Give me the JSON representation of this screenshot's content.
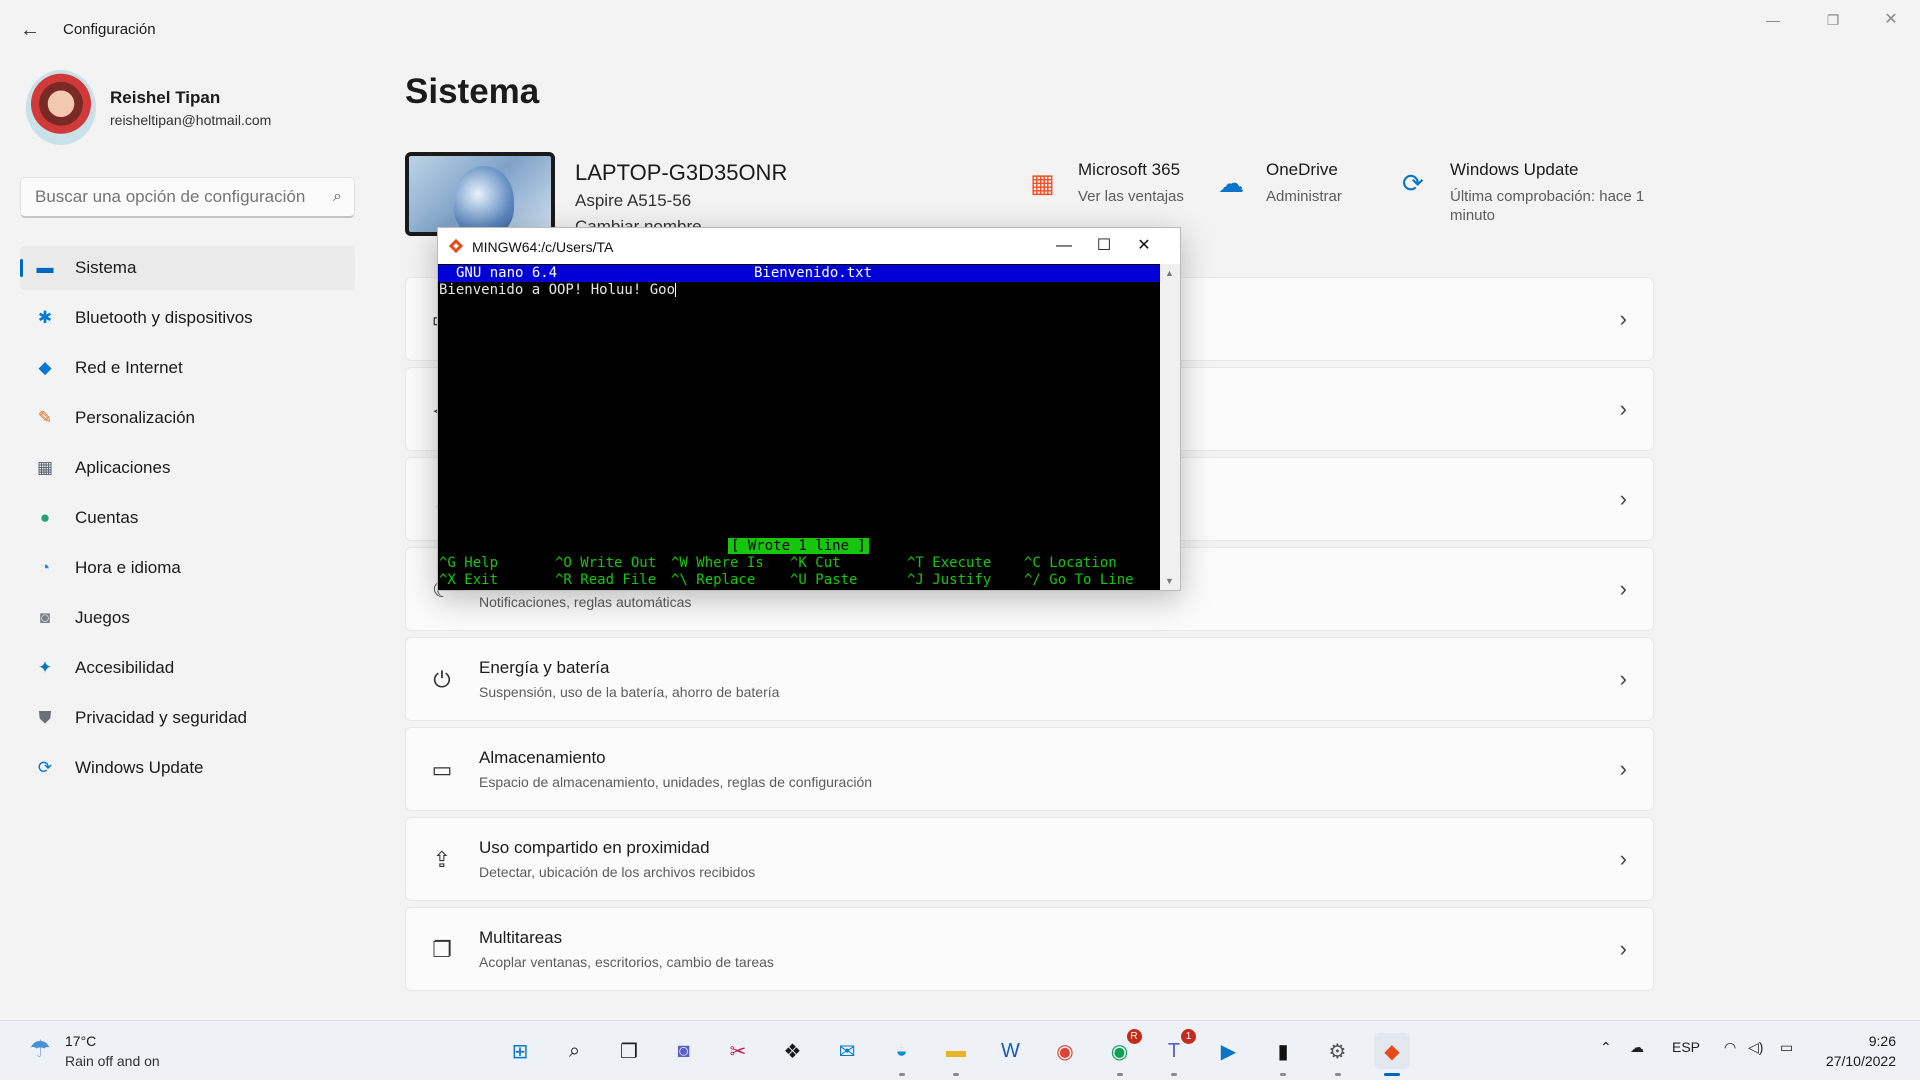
{
  "window": {
    "title": "Configuración",
    "back_icon": "←",
    "min_icon": "—",
    "max_icon": "❐",
    "close_icon": "✕"
  },
  "profile": {
    "name": "Reishel Tipan",
    "email": "reisheltipan@hotmail.com"
  },
  "search": {
    "placeholder": "Buscar una opción de configuración",
    "icon": "⌕"
  },
  "sidebar": {
    "items": [
      {
        "label": "Sistema",
        "icon": "▬",
        "color": "#0067c0",
        "active": true
      },
      {
        "label": "Bluetooth y dispositivos",
        "icon": "✱",
        "color": "#0078d4"
      },
      {
        "label": "Red e Internet",
        "icon": "◆",
        "color": "#0078d4"
      },
      {
        "label": "Personalización",
        "icon": "✎",
        "color": "#d46a1a"
      },
      {
        "label": "Aplicaciones",
        "icon": "▦",
        "color": "#555f6e"
      },
      {
        "label": "Cuentas",
        "icon": "●",
        "color": "#1fa37a"
      },
      {
        "label": "Hora e idioma",
        "icon": "◔",
        "color": "#2f86d6"
      },
      {
        "label": "Juegos",
        "icon": "◙",
        "color": "#7a7f88"
      },
      {
        "label": "Accesibilidad",
        "icon": "✦",
        "color": "#0a74c9"
      },
      {
        "label": "Privacidad y seguridad",
        "icon": "⛊",
        "color": "#6b7079"
      },
      {
        "label": "Windows Update",
        "icon": "⟳",
        "color": "#0a74c9"
      }
    ]
  },
  "main": {
    "title": "Sistema",
    "device": {
      "name": "LAPTOP-G3D35ONR",
      "model": "Aspire A515-56",
      "rename": "Cambiar nombre"
    },
    "tiles": [
      {
        "title": "Microsoft 365",
        "sub": "Ver las ventajas",
        "icon": "▦"
      },
      {
        "title": "OneDrive",
        "sub": "Administrar",
        "icon": "☁"
      },
      {
        "title": "Windows Update",
        "sub": "Última comprobación: hace 1 minuto",
        "icon": "⟳"
      }
    ],
    "cards": [
      {
        "title": "",
        "sub": "",
        "icon": "▭"
      },
      {
        "title": "",
        "sub": "",
        "icon": "◁"
      },
      {
        "title": "",
        "sub": "",
        "icon": "♫"
      },
      {
        "title": "",
        "sub": "Notificaciones, reglas automáticas",
        "icon": "☾"
      },
      {
        "title": "Energía y batería",
        "sub": "Suspensión, uso de la batería, ahorro de batería",
        "icon": "⏻"
      },
      {
        "title": "Almacenamiento",
        "sub": "Espacio de almacenamiento, unidades, reglas de configuración",
        "icon": "▭"
      },
      {
        "title": "Uso compartido en proximidad",
        "sub": "Detectar, ubicación de los archivos recibidos",
        "icon": "⇪"
      },
      {
        "title": "Multitareas",
        "sub": "Acoplar ventanas, escritorios, cambio de tareas",
        "icon": "❐"
      }
    ],
    "chevron": "›"
  },
  "terminal": {
    "title": "MINGW64:/c/Users/TA",
    "min_icon": "—",
    "max_icon": "☐",
    "close_icon": "✕",
    "nano_version": "GNU nano 6.4",
    "filename": "Bienvenido.txt",
    "content": "Bienvenido a OOP! Holuu! Goo",
    "status": "[ Wrote 1 line ]",
    "shortcuts_row1": [
      "^G Help",
      "^O Write Out",
      "^W Where Is",
      "^K Cut",
      "^T Execute",
      "^C Location"
    ],
    "shortcuts_row2": [
      "^X Exit",
      "^R Read File",
      "^\\ Replace",
      "^U Paste",
      "^J Justify",
      "^/ Go To Line"
    ]
  },
  "taskbar": {
    "weather": {
      "temp": "17°C",
      "desc": "Rain off and on",
      "icon": "☂"
    },
    "apps": [
      {
        "name": "start",
        "icon": "⊞",
        "color": "#0078d4"
      },
      {
        "name": "search",
        "icon": "⌕",
        "color": "#222"
      },
      {
        "name": "task-view",
        "icon": "❐",
        "color": "#222"
      },
      {
        "name": "chat",
        "icon": "◙",
        "color": "#5b5fc7"
      },
      {
        "name": "snipping-tool",
        "icon": "✂",
        "color": "#c2185b"
      },
      {
        "name": "dropbox",
        "icon": "❖",
        "color": "#1a1a1a"
      },
      {
        "name": "mail",
        "icon": "✉",
        "color": "#0078d4"
      },
      {
        "name": "edge",
        "icon": "◒",
        "color": "#0c8bd6"
      },
      {
        "name": "file-explorer",
        "icon": "▬",
        "color": "#e8b22a"
      },
      {
        "name": "word",
        "icon": "W",
        "color": "#185abd"
      },
      {
        "name": "chrome",
        "icon": "◉",
        "color": "#db4437"
      },
      {
        "name": "chrome-profile",
        "icon": "◉",
        "color": "#0f9d58",
        "badge": "R"
      },
      {
        "name": "teams",
        "icon": "T",
        "color": "#5b5fc7",
        "badge": "1"
      },
      {
        "name": "media-player",
        "icon": "▶",
        "color": "#0a74c9"
      },
      {
        "name": "terminal",
        "icon": "▮",
        "color": "#111"
      },
      {
        "name": "settings",
        "icon": "⚙",
        "color": "#555"
      },
      {
        "name": "git-bash",
        "icon": "◆",
        "color": "#e64a19"
      }
    ],
    "tray": {
      "chevron": "⌃",
      "cloud": "☁",
      "lang": "ESP",
      "wifi": "◠",
      "volume": "◁)",
      "battery": "▭"
    },
    "time": "9:26",
    "date": "27/10/2022"
  }
}
